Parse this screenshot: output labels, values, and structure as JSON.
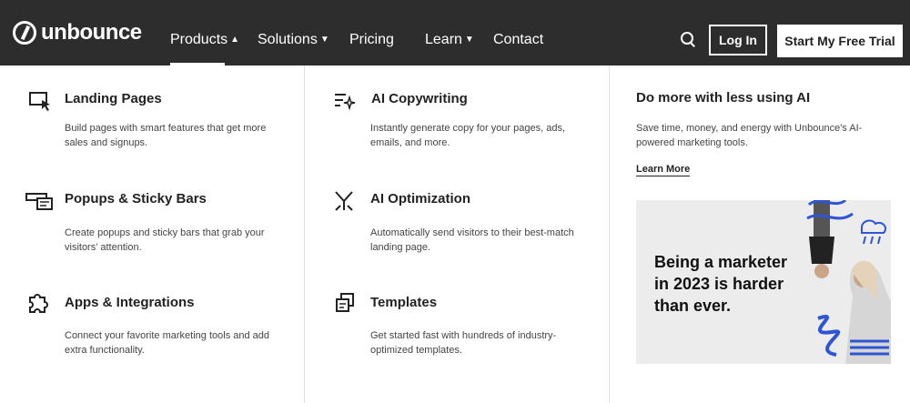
{
  "nav": {
    "logo_text": "unbounce",
    "items": [
      {
        "label": "Products",
        "chevron": "up"
      },
      {
        "label": "Solutions",
        "chevron": "down"
      },
      {
        "label": "Pricing"
      },
      {
        "label": "Learn",
        "chevron": "down"
      },
      {
        "label": "Contact"
      }
    ],
    "login_label": "Log In",
    "trial_label": "Start My Free Trial"
  },
  "menu": {
    "items": [
      {
        "icon": "landing-page-icon",
        "title": "Landing Pages",
        "desc": "Build pages with smart features that get more sales and signups."
      },
      {
        "icon": "popup-icon",
        "title": "Popups & Sticky Bars",
        "desc": "Create popups and sticky bars that grab your visitors' attention."
      },
      {
        "icon": "puzzle-icon",
        "title": "Apps & Integrations",
        "desc": "Connect your favorite marketing tools and add extra functionality."
      },
      {
        "icon": "sparkle-lines-icon",
        "title": "AI Copywriting",
        "desc": "Instantly generate copy for your pages, ads, emails, and more."
      },
      {
        "icon": "split-arrows-icon",
        "title": "AI Optimization",
        "desc": "Automatically send visitors to their best-match landing page."
      },
      {
        "icon": "templates-icon",
        "title": "Templates",
        "desc": "Get started fast with hundreds of industry-optimized templates."
      }
    ]
  },
  "ai_panel": {
    "title": "Do more with less using AI",
    "desc": "Save time, money, and energy with Unbounce's AI-powered marketing tools.",
    "link": "Learn More",
    "promo_text": "Being a marketer in 2023 is harder than ever."
  },
  "colors": {
    "nav_bg": "#2d2d2d",
    "accent_blue": "#2f55d4"
  }
}
